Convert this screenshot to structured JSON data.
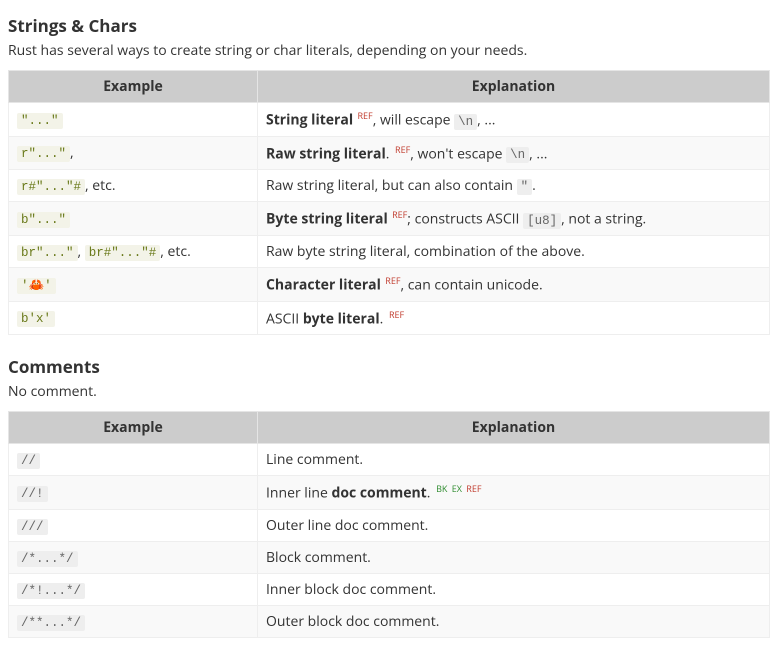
{
  "sections": [
    {
      "title": "Strings & Chars",
      "lead": "Rust has several ways to create string or char literals, depending on your needs.",
      "headers": [
        "Example",
        "Explanation"
      ],
      "rows": [
        {
          "example": [
            {
              "type": "code",
              "text": "\"...\""
            }
          ],
          "explanation": [
            {
              "type": "b",
              "text": "String literal"
            },
            {
              "type": "sup",
              "class": "ref",
              "text": " REF"
            },
            {
              "type": "text",
              "text": ", will escape "
            },
            {
              "type": "code",
              "class": "plain",
              "text": "\\n"
            },
            {
              "type": "text",
              "text": ", ..."
            }
          ]
        },
        {
          "example": [
            {
              "type": "code",
              "text": "r\"...\""
            },
            {
              "type": "text",
              "text": ","
            }
          ],
          "explanation": [
            {
              "type": "b",
              "text": "Raw string literal"
            },
            {
              "type": "text",
              "text": ". "
            },
            {
              "type": "sup",
              "class": "ref",
              "text": "REF"
            },
            {
              "type": "text",
              "text": ", won't escape "
            },
            {
              "type": "code",
              "class": "plain",
              "text": "\\n"
            },
            {
              "type": "text",
              "text": ", ..."
            }
          ]
        },
        {
          "example": [
            {
              "type": "code",
              "text": "r#\"...\"#"
            },
            {
              "type": "text",
              "text": ", etc."
            }
          ],
          "explanation": [
            {
              "type": "text",
              "text": "Raw string literal, but can also contain "
            },
            {
              "type": "code",
              "class": "plain",
              "text": "\""
            },
            {
              "type": "text",
              "text": "."
            }
          ]
        },
        {
          "example": [
            {
              "type": "code",
              "text": "b\"...\""
            }
          ],
          "explanation": [
            {
              "type": "b",
              "text": "Byte string literal"
            },
            {
              "type": "sup",
              "class": "ref",
              "text": " REF"
            },
            {
              "type": "text",
              "text": "; constructs ASCII "
            },
            {
              "type": "code",
              "class": "plain",
              "text": "[u8]"
            },
            {
              "type": "text",
              "text": ", not a string."
            }
          ]
        },
        {
          "example": [
            {
              "type": "code",
              "text": "br\"...\""
            },
            {
              "type": "text",
              "text": ", "
            },
            {
              "type": "code",
              "text": "br#\"...\"#"
            },
            {
              "type": "text",
              "text": ", etc."
            }
          ],
          "explanation": [
            {
              "type": "text",
              "text": "Raw byte string literal, combination of the above."
            }
          ]
        },
        {
          "example": [
            {
              "type": "code",
              "html": "'<span class=\"emoji\">🦀</span>'"
            }
          ],
          "explanation": [
            {
              "type": "b",
              "text": "Character literal"
            },
            {
              "type": "sup",
              "class": "ref",
              "text": " REF"
            },
            {
              "type": "text",
              "text": ", can contain unicode."
            }
          ]
        },
        {
          "example": [
            {
              "type": "code",
              "text": "b'x'"
            }
          ],
          "explanation": [
            {
              "type": "text",
              "text": "ASCII "
            },
            {
              "type": "b",
              "text": "byte literal"
            },
            {
              "type": "text",
              "text": ". "
            },
            {
              "type": "sup",
              "class": "ref",
              "text": "REF"
            }
          ]
        }
      ]
    },
    {
      "title": "Comments",
      "lead": "No comment.",
      "headers": [
        "Example",
        "Explanation"
      ],
      "rows": [
        {
          "example": [
            {
              "type": "code",
              "class": "plain",
              "text": "//"
            }
          ],
          "explanation": [
            {
              "type": "text",
              "text": "Line comment."
            }
          ]
        },
        {
          "example": [
            {
              "type": "code",
              "class": "plain",
              "text": "//!"
            }
          ],
          "explanation": [
            {
              "type": "text",
              "text": "Inner line "
            },
            {
              "type": "b",
              "text": "doc comment"
            },
            {
              "type": "text",
              "text": ". "
            },
            {
              "type": "sup",
              "class": "bk",
              "text": "BK"
            },
            {
              "type": "sup",
              "class": "ex",
              "text": " EX"
            },
            {
              "type": "sup",
              "class": "ref",
              "text": " REF"
            }
          ]
        },
        {
          "example": [
            {
              "type": "code",
              "class": "plain",
              "text": "///"
            }
          ],
          "explanation": [
            {
              "type": "text",
              "text": "Outer line doc comment."
            }
          ]
        },
        {
          "example": [
            {
              "type": "code",
              "class": "plain",
              "text": "/*...*/"
            }
          ],
          "explanation": [
            {
              "type": "text",
              "text": "Block comment."
            }
          ]
        },
        {
          "example": [
            {
              "type": "code",
              "class": "plain",
              "text": "/*!...*/"
            }
          ],
          "explanation": [
            {
              "type": "text",
              "text": "Inner block doc comment."
            }
          ]
        },
        {
          "example": [
            {
              "type": "code",
              "class": "plain",
              "text": "/**...*/"
            }
          ],
          "explanation": [
            {
              "type": "text",
              "text": "Outer block doc comment."
            }
          ]
        }
      ]
    }
  ]
}
